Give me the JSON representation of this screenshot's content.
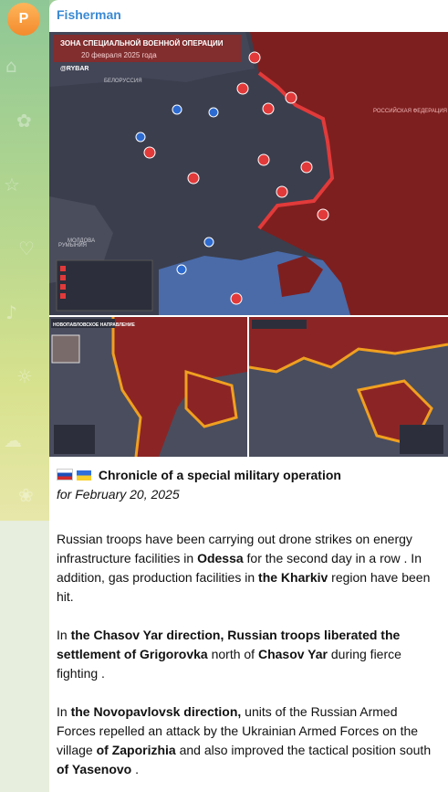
{
  "channel": {
    "avatar_letter": "P",
    "sender": "Fisherman"
  },
  "map": {
    "title": "ЗОНА СПЕЦИАЛЬНОЙ ВОЕННОЙ ОПЕРАЦИИ",
    "subtitle": "20 февраля 2025 года",
    "brand": "@RYBAR",
    "label_belarus": "БЕЛОРУССИЯ",
    "label_russia": "РОССИЙСКАЯ ФЕДЕРАЦИЯ",
    "label_moldova": "МОЛДОВА",
    "label_romania": "РУМЫНИЯ",
    "inset_left_title": "НОВОПАВЛОВСКОЕ НАПРАВЛЕНИЕ"
  },
  "post": {
    "title": "Chronicle of a special military operation",
    "date": "for February 20, 2025",
    "p1_a": "Russian troops have been carrying out drone strikes on energy infrastructure facilities in ",
    "p1_b": "Odessa",
    "p1_c": " for the second day in a row . In addition, gas production facilities in ",
    "p1_d": "the Kharkiv",
    "p1_e": " region have been hit.",
    "p2_a": "In ",
    "p2_b": "the Chasov Yar direction, Russian troops liberated the settlement of Grigorovka",
    "p2_c": " north of ",
    "p2_d": "Chasov Yar",
    "p2_e": " during fierce fighting .",
    "p3_a": "In ",
    "p3_b": "the Novopavlovsk direction,",
    "p3_c": " units of the Russian Armed Forces repelled an attack by the Ukrainian Armed Forces on the village ",
    "p3_d": "of Zaporizhia",
    "p3_e": " and also improved the tactical position south ",
    "p3_f": "of Yasenovo",
    "p3_g": " ."
  },
  "colors": {
    "russia": "#7e1f1f",
    "ukraine": "#3b3e4d",
    "front": "#e23a3a",
    "sea": "#4a6ba8",
    "accent_name": "#3a8ad3"
  }
}
